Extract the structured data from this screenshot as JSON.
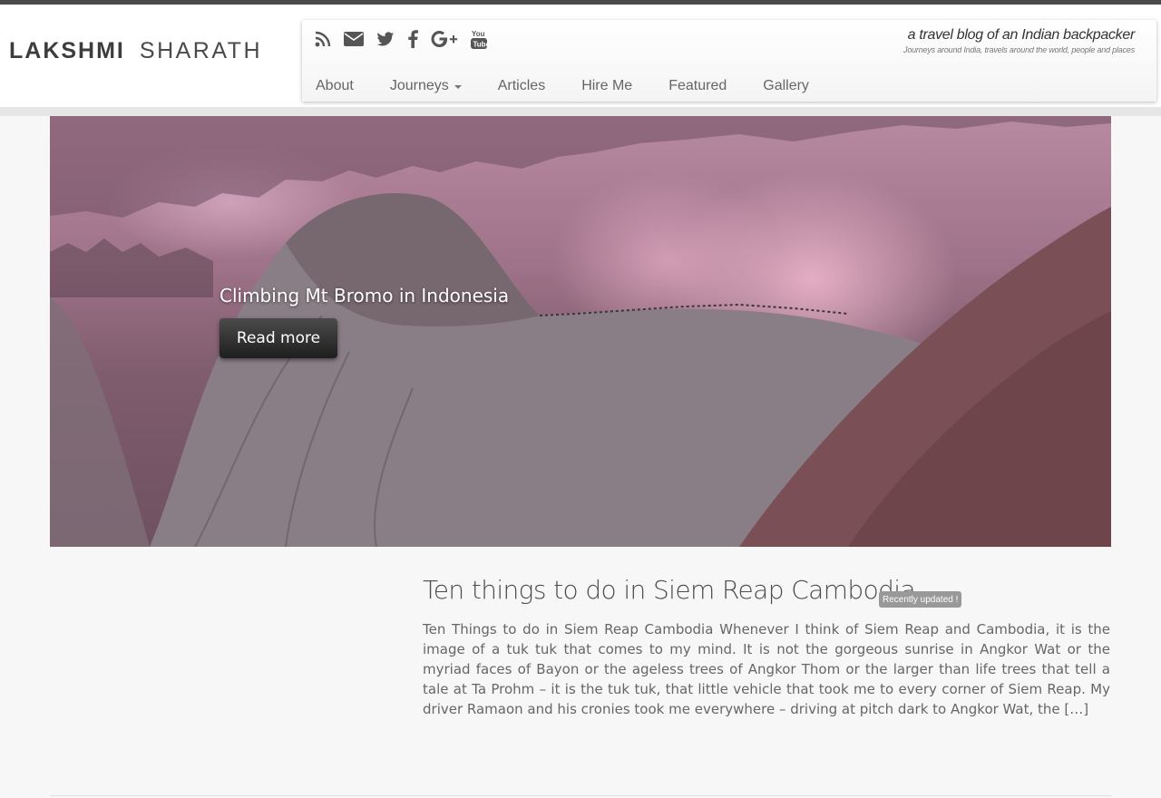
{
  "header": {
    "logo_first": "LAKSHMI",
    "logo_last": "SHARATH",
    "tagline": "a travel blog of an Indian backpacker",
    "subtagline": "Journeys around India, travels around the world, people and places"
  },
  "social_icons": [
    "rss-icon",
    "envelope-icon",
    "twitter-icon",
    "facebook-icon",
    "google-plus-icon",
    "youtube-icon"
  ],
  "nav": {
    "items": [
      "About",
      "Journeys",
      "Articles",
      "Hire Me",
      "Featured",
      "Gallery"
    ]
  },
  "hero": {
    "title": "Climbing Mt Bromo in Indonesia",
    "button": "Read more"
  },
  "post": {
    "title": "Ten things to do in Siem Reap Cambodia",
    "badge": "Recently updated !",
    "excerpt": "Ten Things to do in Siem Reap Cambodia Whenever I think of Siem Reap and Cambodia, it is the image of a tuk tuk that comes to my mind. It is not the gorgeous sunrise in Angkor Wat or the myriad faces of Bayon or the ageless trees of Angkor Thom or the larger than life trees that tell a tale at Ta Prohm – it is the tuk tuk, that little vehicle that took me to every corner of Siem Reap. My driver Ramaon and his cronies took me everywhere – driving at pitch dark to Angkor Wat,  the […]"
  },
  "colors": {
    "top_strip": "#4a4a4a",
    "badge": "#999999",
    "button_dark": "#2a2a2a"
  }
}
